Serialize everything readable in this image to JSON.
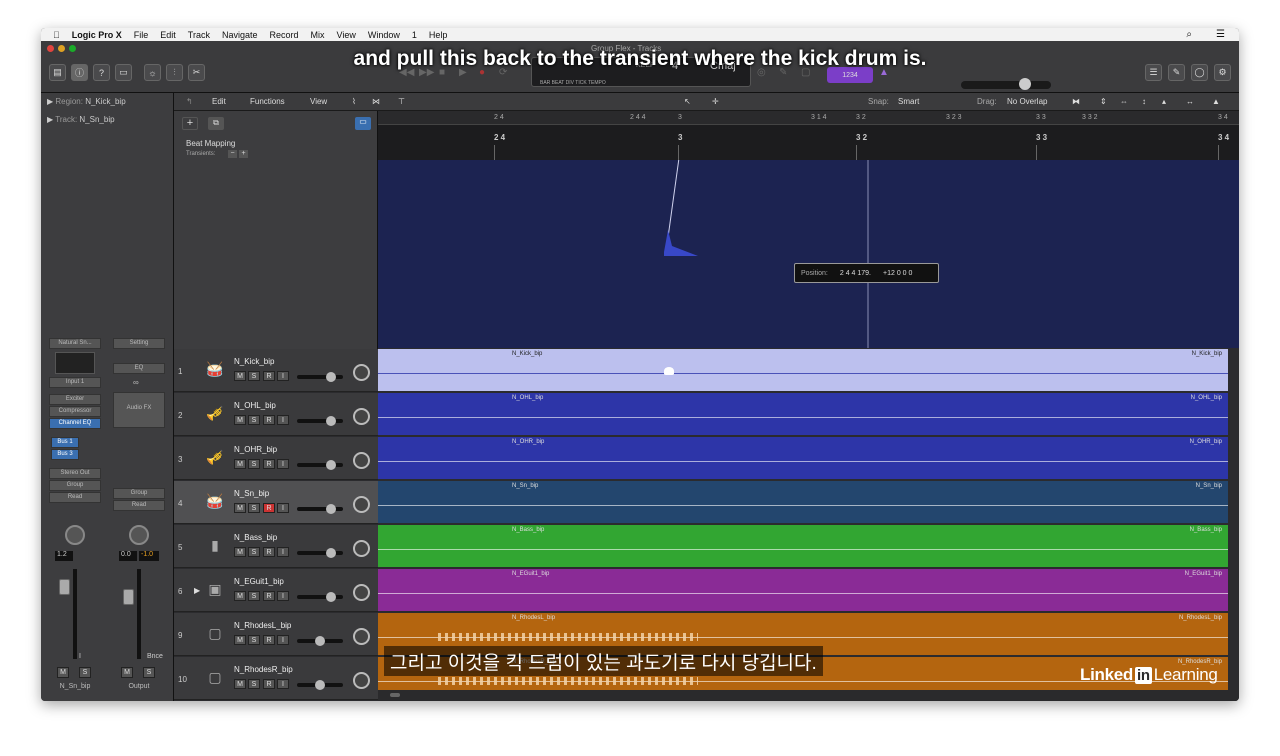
{
  "menubar": {
    "apple": "",
    "app": "Logic Pro X",
    "items": [
      "File",
      "Edit",
      "Track",
      "Navigate",
      "Record",
      "Mix",
      "View",
      "Window",
      "1",
      "Help"
    ],
    "right_icons": [
      "search-icon",
      "list-icon"
    ]
  },
  "window_title": "Group Flex - Tracks",
  "lcd": {
    "bar_labels": "BAR  BEAT  DIV  TICK  TEMPO",
    "key": "KEEP",
    "sig": "4",
    "key_value": "Cmaj",
    "tempo_box": "1234"
  },
  "subtitle_en": "and pull this back to the transient where the kick drum is.",
  "subtitle_ko": "그리고 이것을 킥 드럼이 있는 과도기로 다시 당깁니다.",
  "watermark": {
    "part1": "Linked",
    "part2": "in",
    "part3": "Learning"
  },
  "inspector": {
    "region_label": "Region:",
    "region_value": "N_Kick_bip",
    "track_label": "Track:",
    "track_value": "N_Sn_bip",
    "strip1": {
      "setting": "Natural Sn...",
      "input": "Input 1",
      "plugins": [
        "Exciter",
        "Compressor",
        "Channel EQ"
      ],
      "sends": [
        "Bus 1",
        "Bus 3"
      ],
      "output": "Stereo Out",
      "group": "Group",
      "automation": "Read",
      "vol": "1.2",
      "name": "N_Sn_bip"
    },
    "strip2": {
      "setting": "Setting",
      "eq": "EQ",
      "audiofx": "Audio FX",
      "group": "Group",
      "automation": "Read",
      "vol": "0.0",
      "peak": "-1.0",
      "bnce": "Bnce",
      "name": "Output"
    },
    "mute": "M",
    "solo": "S",
    "i_label": "I"
  },
  "main_toolbar": {
    "edit": "Edit",
    "functions": "Functions",
    "view": "View",
    "snap_label": "Snap:",
    "snap_value": "Smart",
    "drag_label": "Drag:",
    "drag_value": "No Overlap"
  },
  "top_panel": {
    "title": "Beat Mapping",
    "transients": "Transients:",
    "add": "+",
    "minus": "−"
  },
  "ruler_top": [
    "2 4",
    "2 4 4",
    "3",
    "3 1 4",
    "3 2",
    "3 2 3",
    "3 3",
    "3 3 2",
    "3 4"
  ],
  "beat_ruler": [
    "2 4",
    "3",
    "3 2",
    "3 3",
    "3 4"
  ],
  "tooltip": {
    "label": "Position:",
    "position": "2 4 4 179.",
    "offset": "+12 0 0 0"
  },
  "tracks": [
    {
      "num": "1",
      "name": "N_Kick_bip",
      "region": "N_Kick_bip",
      "color": "#bcc0ee",
      "selected": false,
      "vol": 0.72
    },
    {
      "num": "2",
      "name": "N_OHL_bip",
      "region": "N_OHL_bip",
      "color": "#2d35a8",
      "selected": false,
      "vol": 0.72
    },
    {
      "num": "3",
      "name": "N_OHR_bip",
      "region": "N_OHR_bip",
      "color": "#2d35a8",
      "selected": false,
      "vol": 0.72
    },
    {
      "num": "4",
      "name": "N_Sn_bip",
      "region": "N_Sn_bip",
      "color": "#23466e",
      "selected": true,
      "vol": 0.72
    },
    {
      "num": "5",
      "name": "N_Bass_bip",
      "region": "N_Bass_bip",
      "color": "#32a632",
      "selected": false,
      "vol": 0.72
    },
    {
      "num": "6",
      "name": "N_EGuit1_bip",
      "region": "N_EGuit1_bip",
      "color": "#8a2b96",
      "selected": false,
      "vol": 0.72
    },
    {
      "num": "9",
      "name": "N_RhodesL_bip",
      "region": "N_RhodesL_bip",
      "color": "#b4650f",
      "selected": false,
      "vol": 0.45
    },
    {
      "num": "10",
      "name": "N_RhodesR_bip",
      "region": "N_RhodesR_bip",
      "color": "#b4650f",
      "selected": false,
      "vol": 0.45
    }
  ],
  "track_buttons": {
    "m": "M",
    "s": "S",
    "r": "R",
    "i": "I"
  }
}
